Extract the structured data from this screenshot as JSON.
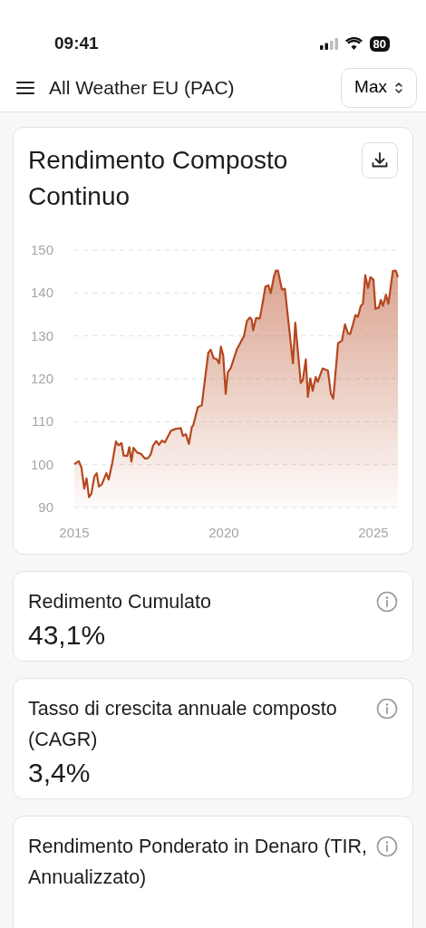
{
  "status_bar": {
    "time": "09:41",
    "battery": "80"
  },
  "header": {
    "title": "All Weather EU (PAC)",
    "range_select": {
      "value": "Max"
    }
  },
  "chart_card": {
    "title": "Rendimento Composto Continuo",
    "chart_data": {
      "type": "area",
      "x": [
        2015.0,
        2015.15,
        2015.24,
        2015.33,
        2015.41,
        2015.49,
        2015.57,
        2015.67,
        2015.75,
        2015.82,
        2015.92,
        2016.07,
        2016.15,
        2016.27,
        2016.39,
        2016.48,
        2016.58,
        2016.65,
        2016.77,
        2016.84,
        2016.91,
        2016.98,
        2017.1,
        2017.23,
        2017.36,
        2017.46,
        2017.56,
        2017.63,
        2017.74,
        2017.83,
        2017.93,
        2018.03,
        2018.23,
        2018.38,
        2018.56,
        2018.63,
        2018.73,
        2018.83,
        2018.93,
        2018.98,
        2019.13,
        2019.26,
        2019.48,
        2019.56,
        2019.66,
        2019.76,
        2019.84,
        2019.9,
        2019.98,
        2020.06,
        2020.13,
        2020.23,
        2020.43,
        2020.59,
        2020.67,
        2020.77,
        2020.87,
        2020.93,
        2020.98,
        2021.08,
        2021.2,
        2021.27,
        2021.39,
        2021.49,
        2021.57,
        2021.67,
        2021.74,
        2021.81,
        2021.94,
        2022.04,
        2022.31,
        2022.39,
        2022.57,
        2022.64,
        2022.74,
        2022.81,
        2022.89,
        2022.97,
        2023.07,
        2023.14,
        2023.3,
        2023.48,
        2023.58,
        2023.66,
        2023.82,
        2023.95,
        2024.05,
        2024.15,
        2024.23,
        2024.4,
        2024.48,
        2024.58,
        2024.65,
        2024.73,
        2024.82,
        2024.9,
        2025.0,
        2025.07,
        2025.18,
        2025.25,
        2025.32,
        2025.42,
        2025.5,
        2025.65,
        2025.75,
        2025.82
      ],
      "series": [
        {
          "color": "#b5471f",
          "values": [
            100.1,
            100.8,
            99.3,
            94.4,
            96.8,
            92.4,
            93.2,
            97.2,
            98.0,
            94.9,
            95.4,
            98.0,
            96.5,
            100.4,
            105.4,
            104.5,
            105.0,
            102.1,
            102.0,
            104.1,
            100.7,
            103.9,
            102.8,
            102.5,
            101.4,
            101.5,
            102.5,
            104.4,
            105.5,
            104.6,
            105.6,
            105.2,
            107.9,
            108.3,
            108.5,
            106.7,
            107.1,
            104.8,
            108.8,
            109.2,
            113.4,
            113.8,
            126.1,
            126.8,
            124.8,
            124.6,
            123.6,
            127.5,
            125.4,
            116.5,
            121.5,
            122.5,
            126.8,
            128.9,
            129.9,
            133.5,
            134.3,
            133.8,
            131.3,
            134.2,
            134.1,
            136.6,
            141.5,
            141.8,
            140.0,
            143.7,
            145.2,
            145.2,
            140.8,
            141.0,
            123.6,
            133.1,
            119.0,
            119.7,
            124.5,
            115.8,
            120.1,
            117.2,
            120.4,
            119.3,
            122.4,
            121.9,
            116.5,
            115.4,
            128.3,
            128.9,
            132.7,
            130.6,
            130.5,
            134.9,
            134.4,
            137.0,
            137.5,
            144.2,
            141.2,
            143.7,
            143.1,
            136.3,
            136.6,
            138.4,
            137.0,
            139.6,
            137.5,
            145.1,
            145.2,
            143.7
          ]
        }
      ],
      "grid": true,
      "xlim": [
        2015,
        2025.85
      ],
      "ylim": [
        90,
        150
      ],
      "xticks": [
        2015,
        2020,
        2025
      ],
      "yticks": [
        90,
        100,
        110,
        120,
        130,
        140,
        150
      ]
    }
  },
  "metrics": [
    {
      "label": "Redimento Cumulato",
      "value": "43,1%"
    },
    {
      "label": "Tasso di crescita annuale composto (CAGR)",
      "value": "3,4%"
    },
    {
      "label": "Rendimento Ponderato in Denaro (TIR, Annualizzato)"
    }
  ]
}
